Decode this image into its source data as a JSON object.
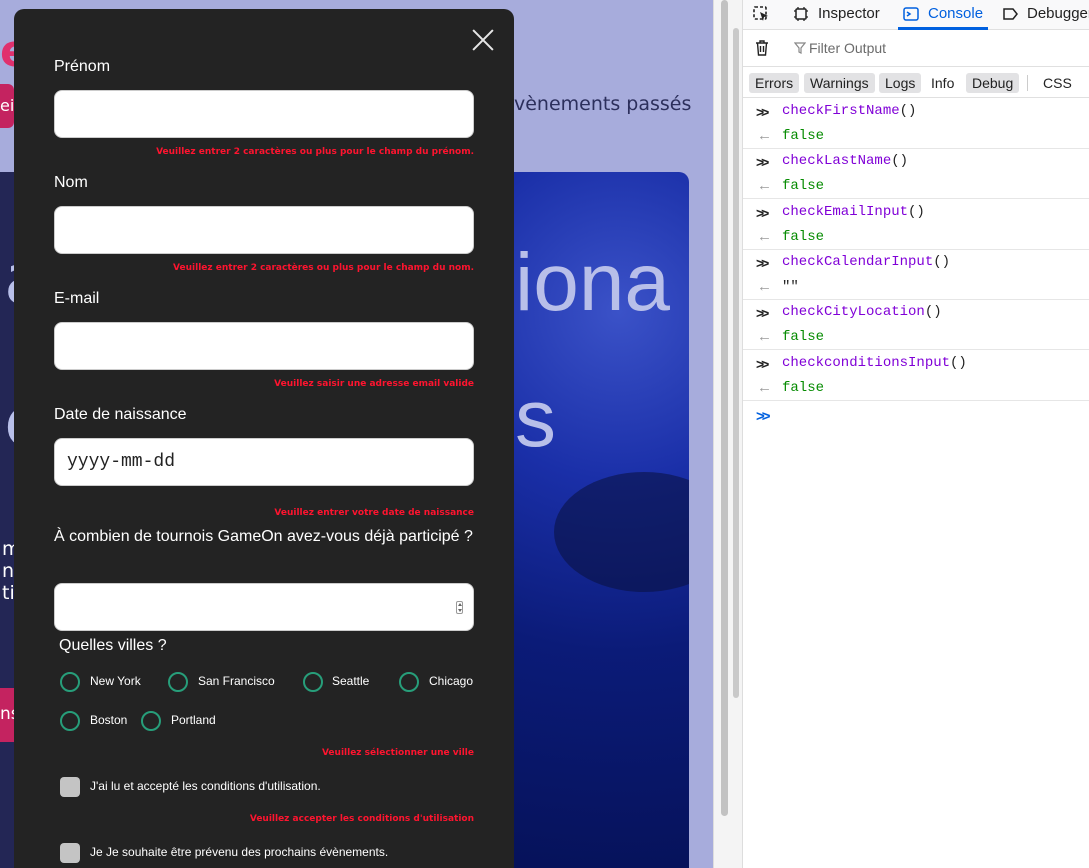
{
  "background": {
    "logo_fragment": "e",
    "pill_fragment": "eil",
    "nav_text": "vènements passés",
    "hero_line1": "iona",
    "hero_line2": "s",
    "side_text": [
      "m",
      "ne",
      "ti"
    ],
    "button_fragment": "ns"
  },
  "modal": {
    "fields": [
      {
        "label": "Prénom",
        "value": "",
        "error": "Veuillez entrer 2 caractères ou plus pour le champ du prénom."
      },
      {
        "label": "Nom",
        "value": "",
        "error": "Veuillez entrer 2 caractères ou plus pour le champ du nom."
      },
      {
        "label": "E-mail",
        "value": "",
        "error": "Veuillez saisir une adresse email valide"
      },
      {
        "label": "Date de naissance",
        "value": "yyyy-mm-dd",
        "error": "Veuillez entrer votre date de naissance"
      }
    ],
    "question": "À combien de tournois GameOn avez-vous déjà participé ?",
    "quantity_value": "",
    "cities_title": "Quelles villes ?",
    "cities": [
      "New York",
      "San Francisco",
      "Seattle",
      "Chicago",
      "Boston",
      "Portland"
    ],
    "cities_error": "Veuillez sélectionner une ville",
    "conditions_label": "J'ai lu et accepté les conditions d'utilisation.",
    "conditions_error": "Veuillez accepter les conditions d'utilisation",
    "newsletter_label": "Je Je souhaite être prévenu des prochains évènements."
  },
  "devtools": {
    "tabs": [
      "Inspector",
      "Console",
      "Debugger"
    ],
    "active_tab": "Console",
    "filter_placeholder": "Filter Output",
    "levels": [
      "Errors",
      "Warnings",
      "Logs",
      "Info",
      "Debug",
      "CSS"
    ],
    "active_levels": [
      "Errors",
      "Warnings",
      "Logs",
      "Debug"
    ],
    "entries": [
      {
        "input": "checkFirstName",
        "output": "false"
      },
      {
        "input": "checkLastName",
        "output": "false"
      },
      {
        "input": "checkEmailInput",
        "output": "false"
      },
      {
        "input": "checkCalendarInput",
        "output": "\"\""
      },
      {
        "input": "checkCityLocation",
        "output": "false"
      },
      {
        "input": "checkconditionsInput",
        "output": "false"
      }
    ],
    "call_suffix": "()",
    "colors": {
      "accent": "#0060df",
      "function": "#8000d7",
      "boolean": "#058b00"
    }
  }
}
